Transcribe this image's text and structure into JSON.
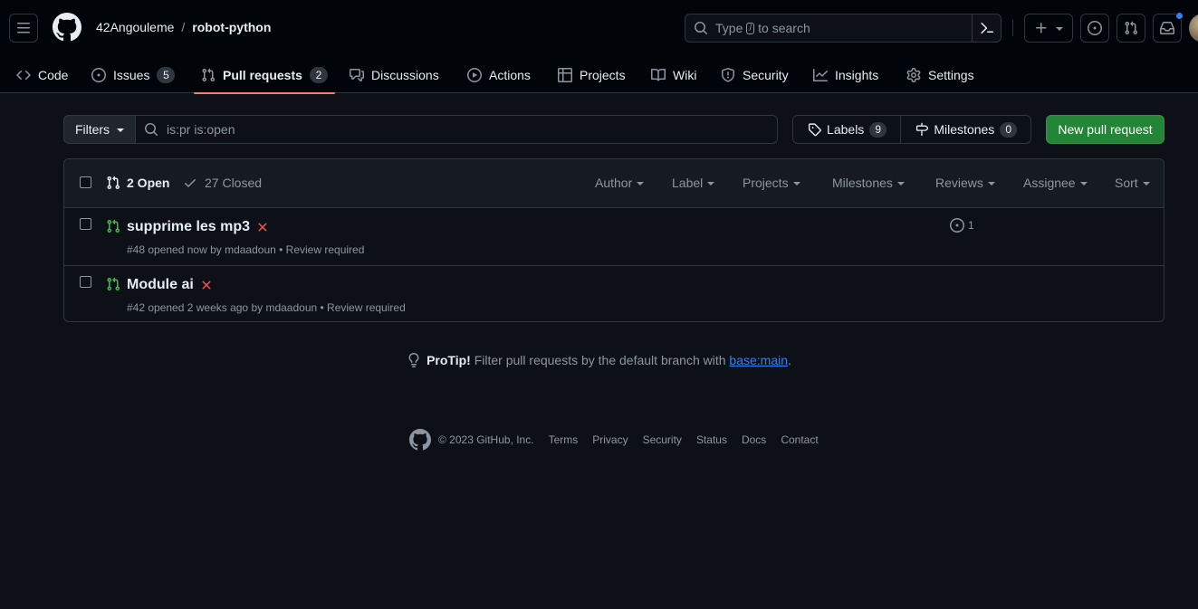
{
  "header": {
    "owner": "42Angouleme",
    "separator": "/",
    "repo": "robot-python",
    "search_prefix": "Type",
    "search_key": "/",
    "search_suffix": "to search"
  },
  "tabs": [
    {
      "label": "Code"
    },
    {
      "label": "Issues",
      "count": "5"
    },
    {
      "label": "Pull requests",
      "count": "2"
    },
    {
      "label": "Discussions"
    },
    {
      "label": "Actions"
    },
    {
      "label": "Projects"
    },
    {
      "label": "Wiki"
    },
    {
      "label": "Security"
    },
    {
      "label": "Insights"
    },
    {
      "label": "Settings"
    }
  ],
  "subnav": {
    "filters_label": "Filters",
    "filter_query": "is:pr is:open",
    "labels_label": "Labels",
    "labels_count": "9",
    "milestones_label": "Milestones",
    "milestones_count": "0",
    "new_pr_label": "New pull request"
  },
  "list": {
    "open_label": "2 Open",
    "closed_label": "27 Closed",
    "filters": [
      "Author",
      "Label",
      "Projects",
      "Milestones",
      "Reviews",
      "Assignee",
      "Sort"
    ],
    "rows": [
      {
        "title": "supprime les mp3",
        "meta": "#48 opened now by mdaadoun • Review required",
        "comments": "1"
      },
      {
        "title": "Module ai",
        "meta": "#42 opened 2 weeks ago by mdaadoun • Review required"
      }
    ]
  },
  "protip": {
    "label": "ProTip!",
    "text": "Filter pull requests by the default branch with",
    "link": "base:main",
    "end": "."
  },
  "footer": {
    "copyright": "© 2023 GitHub, Inc.",
    "links": [
      "Terms",
      "Privacy",
      "Security",
      "Status",
      "Docs",
      "Contact"
    ]
  },
  "colors": {
    "accent_tab": "#f78166",
    "primary_button": "#238636",
    "open_icon": "#3fb950",
    "failed_status": "#f85149",
    "link": "#2f81f7"
  }
}
